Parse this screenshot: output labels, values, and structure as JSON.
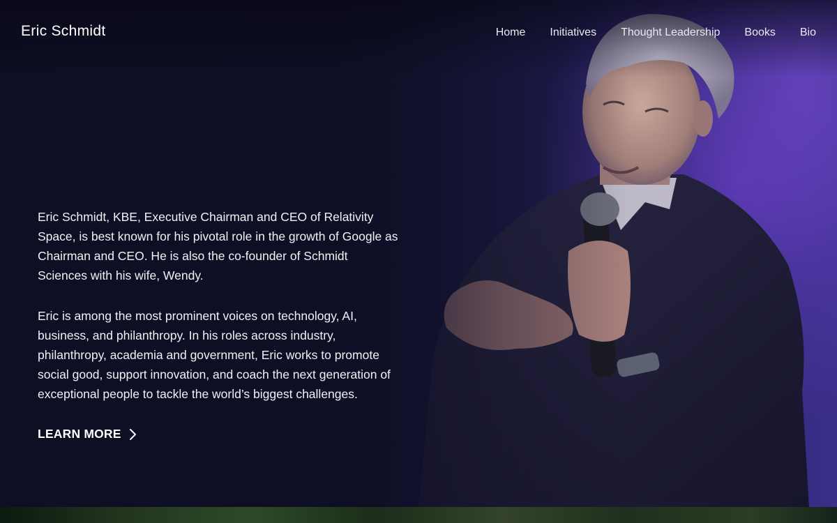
{
  "header": {
    "site_title": "Eric Schmidt",
    "nav": [
      {
        "label": "Home"
      },
      {
        "label": "Initiatives"
      },
      {
        "label": "Thought Leadership"
      },
      {
        "label": "Books"
      },
      {
        "label": "Bio"
      }
    ]
  },
  "hero": {
    "paragraphs": [
      "Eric Schmidt, KBE, Executive Chairman and CEO of Relativity Space, is best known for his pivotal role in the growth of Google as Chairman and CEO. He is also the co-founder of Schmidt Sciences with his wife, Wendy.",
      "Eric is among the most prominent voices on technology, AI, business, and philanthropy. In his roles across industry, philanthropy, academia and government, Eric works to promote social good, support innovation, and coach the next generation of exceptional people to tackle the world’s biggest challenges."
    ],
    "cta_label": "LEARN MORE",
    "cta_icon": "chevron-right-icon",
    "photo_icon": "speaker-portrait"
  },
  "colors": {
    "background": "#0f0f24",
    "accent_purple": "#5a3fc0",
    "text": "#ffffff"
  }
}
